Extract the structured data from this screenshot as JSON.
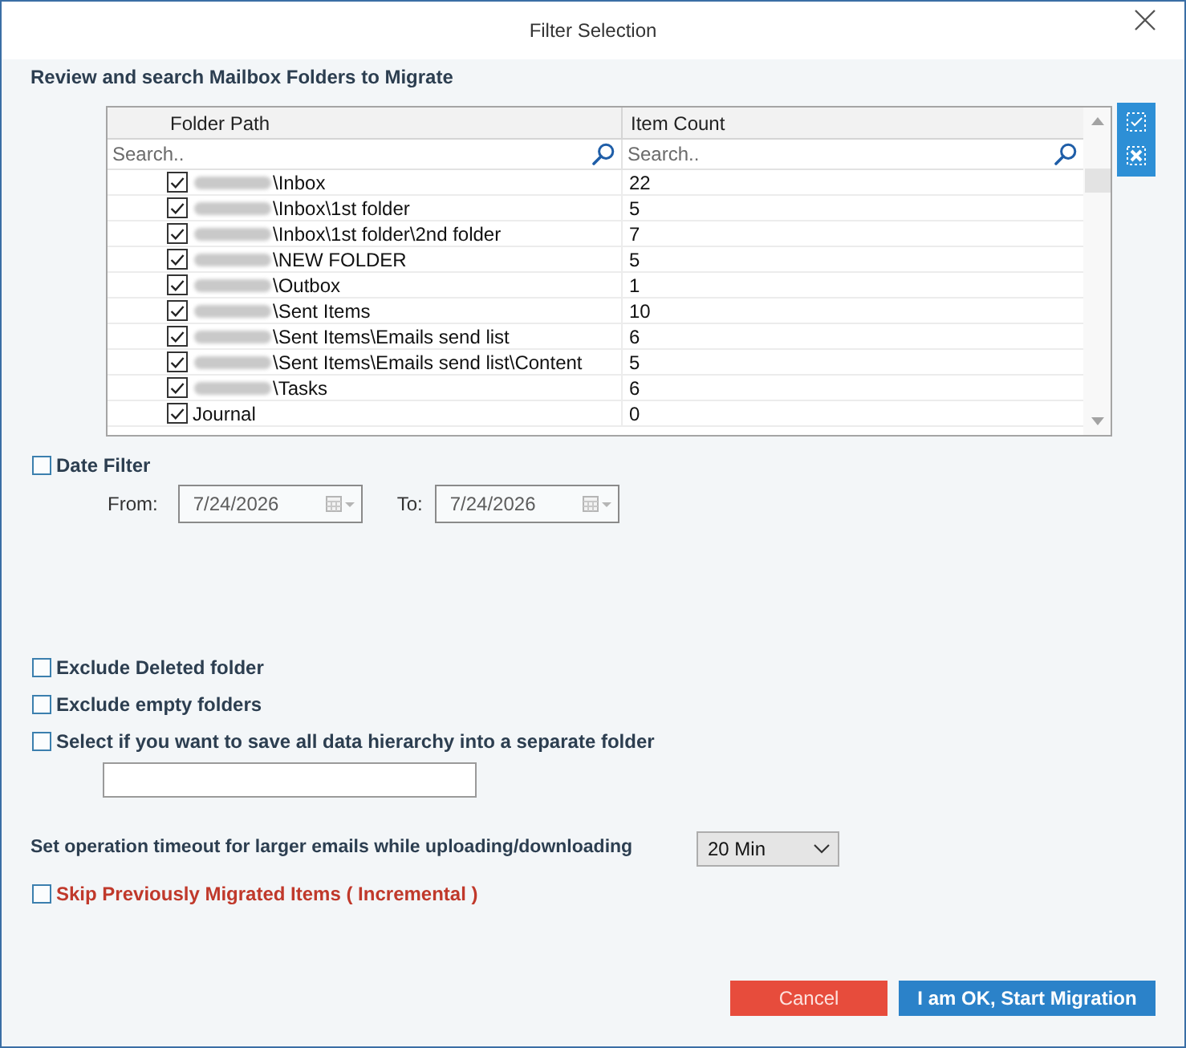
{
  "window": {
    "title": "Filter Selection"
  },
  "folders": {
    "heading": "Review and search Mailbox Folders to Migrate",
    "columns": [
      {
        "label": "Folder Path",
        "search_placeholder": "Search.."
      },
      {
        "label": "Item Count",
        "search_placeholder": "Search.."
      }
    ],
    "rows": [
      {
        "redacted": true,
        "path": "\\Inbox",
        "count": "22",
        "checked": true
      },
      {
        "redacted": true,
        "path": "\\Inbox\\1st folder",
        "count": "5",
        "checked": true
      },
      {
        "redacted": true,
        "path": "\\Inbox\\1st folder\\2nd folder",
        "count": "7",
        "checked": true
      },
      {
        "redacted": true,
        "path": "\\NEW FOLDER",
        "count": "5",
        "checked": true
      },
      {
        "redacted": true,
        "path": "\\Outbox",
        "count": "1",
        "checked": true
      },
      {
        "redacted": true,
        "path": "\\Sent Items",
        "count": "10",
        "checked": true
      },
      {
        "redacted": true,
        "path": "\\Sent Items\\Emails send list",
        "count": "6",
        "checked": true
      },
      {
        "redacted": true,
        "path": "\\Sent Items\\Emails send list\\Content",
        "count": "5",
        "checked": true
      },
      {
        "redacted": true,
        "path": "\\Tasks",
        "count": "6",
        "checked": true
      },
      {
        "redacted": false,
        "path": "Journal",
        "count": "0",
        "checked": true
      }
    ]
  },
  "date_filter": {
    "label": "Date Filter",
    "checked": false,
    "fields": [
      {
        "label": "From:",
        "value": "7/24/2026",
        "disabled": true
      },
      {
        "label": "To:",
        "value": "7/24/2026",
        "disabled": true
      }
    ]
  },
  "options": [
    {
      "label": "Exclude Deleted folder",
      "checked": false
    },
    {
      "label": "Exclude empty folders",
      "checked": false
    },
    {
      "label": "Select if you want to save all data hierarchy into a separate folder",
      "checked": false
    }
  ],
  "timeout": {
    "label": "Set operation timeout for larger emails while uploading/downloading",
    "value": "20 Min"
  },
  "incremental": {
    "label": "Skip Previously Migrated Items ( Incremental )",
    "checked": false
  },
  "buttons": [
    {
      "label": "Cancel",
      "kind": "cancel"
    },
    {
      "label": "I am OK, Start Migration",
      "kind": "primary"
    }
  ]
}
